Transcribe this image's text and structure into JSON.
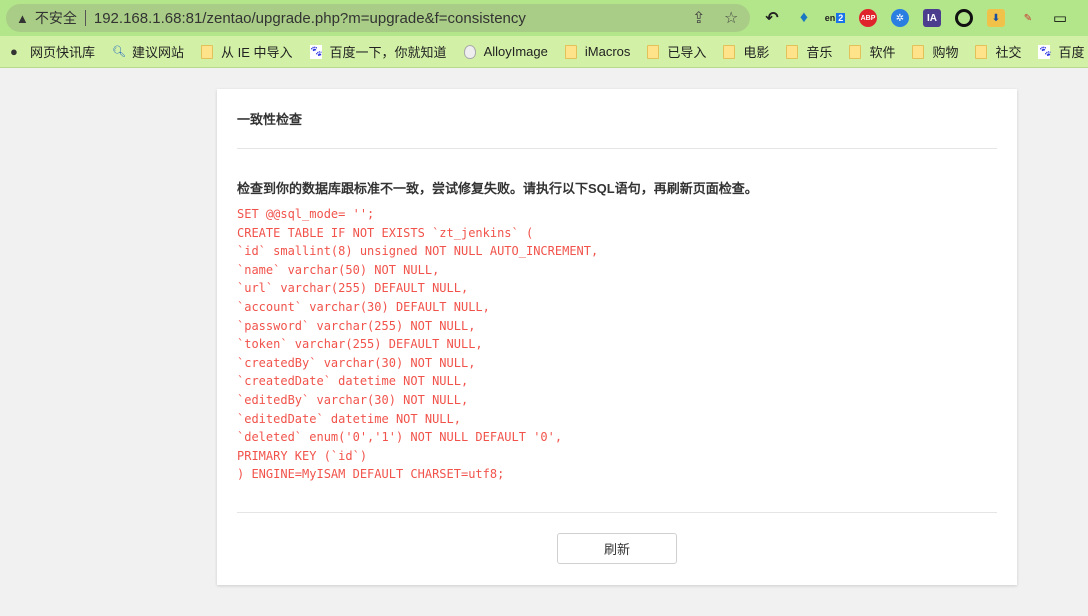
{
  "browser": {
    "security_label": "不安全",
    "url": "192.168.1.68:81/zentao/upgrade.php?m=upgrade&f=consistency",
    "ext_badge": "2",
    "bookmarks": [
      {
        "label": "网页快讯库",
        "icon": "globe-icon"
      },
      {
        "label": "建议网站",
        "icon": "search-icon"
      },
      {
        "label": "从 IE 中导入",
        "icon": "folder-icon"
      },
      {
        "label": "百度一下，你就知道",
        "icon": "baidu-icon"
      },
      {
        "label": "AlloyImage",
        "icon": "egg-icon"
      },
      {
        "label": "iMacros",
        "icon": "folder-icon"
      },
      {
        "label": "已导入",
        "icon": "folder-icon"
      },
      {
        "label": "电影",
        "icon": "folder-icon"
      },
      {
        "label": "音乐",
        "icon": "folder-icon"
      },
      {
        "label": "软件",
        "icon": "folder-icon"
      },
      {
        "label": "购物",
        "icon": "folder-icon"
      },
      {
        "label": "社交",
        "icon": "folder-icon"
      },
      {
        "label": "百度",
        "icon": "baidu-icon"
      }
    ]
  },
  "page": {
    "title": "一致性检查",
    "message": "检查到你的数据库跟标准不一致，尝试修复失败。请执行以下SQL语句，再刷新页面检查。",
    "sql": [
      "SET @@sql_mode= '';",
      "CREATE TABLE IF NOT EXISTS `zt_jenkins` (",
      "`id` smallint(8) unsigned NOT NULL AUTO_INCREMENT,",
      "`name` varchar(50) NOT NULL,",
      "`url` varchar(255) DEFAULT NULL,",
      "`account` varchar(30) DEFAULT NULL,",
      "`password` varchar(255) NOT NULL,",
      "`token` varchar(255) DEFAULT NULL,",
      "`createdBy` varchar(30) NOT NULL,",
      "`createdDate` datetime NOT NULL,",
      "`editedBy` varchar(30) NOT NULL,",
      "`editedDate` datetime NOT NULL,",
      "`deleted` enum('0','1') NOT NULL DEFAULT '0',",
      "PRIMARY KEY (`id`)",
      ") ENGINE=MyISAM DEFAULT CHARSET=utf8;"
    ],
    "refresh_label": "刷新"
  },
  "colors": {
    "sql": "#f1534b",
    "topbar": "#b3e68a",
    "bookmarks": "#d2f1a6"
  }
}
